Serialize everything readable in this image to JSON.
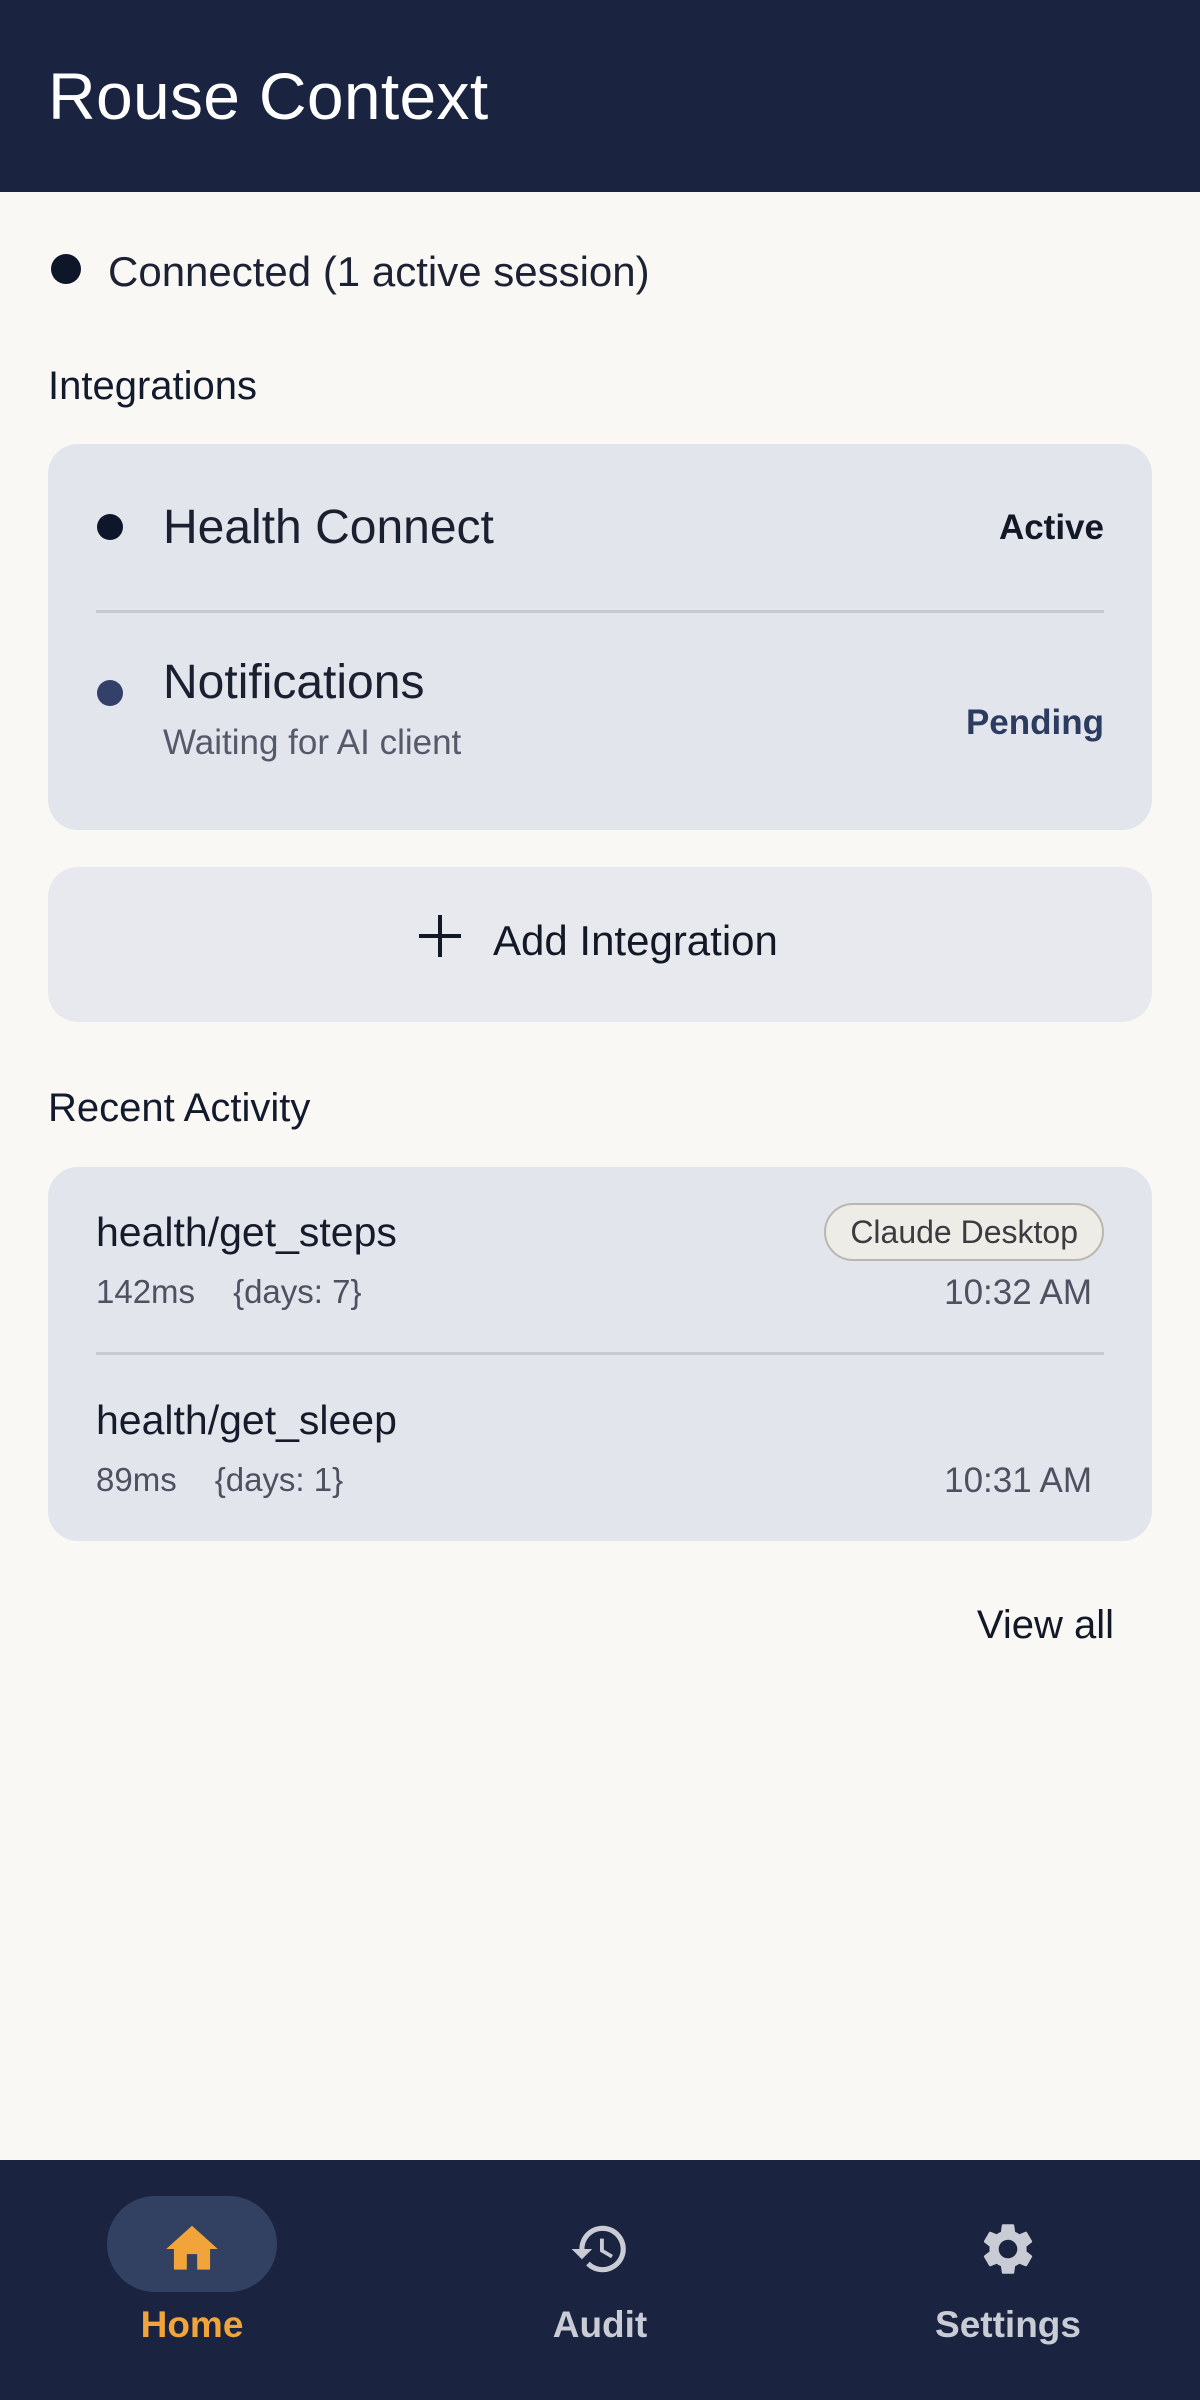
{
  "app": {
    "title": "Rouse Context"
  },
  "connection": {
    "status_text": "Connected (1 active session)"
  },
  "integrations": {
    "title": "Integrations",
    "items": [
      {
        "name": "Health Connect",
        "subtitle": "",
        "status": "Active",
        "status_color": "#121826",
        "dot_color": "#0e1729"
      },
      {
        "name": "Notifications",
        "subtitle": "Waiting for AI client",
        "status": "Pending",
        "status_color": "#2c3c60",
        "dot_color": "#32406a"
      }
    ],
    "add_label": "Add Integration"
  },
  "activity": {
    "title": "Recent Activity",
    "items": [
      {
        "tool": "health/get_steps",
        "duration": "142ms",
        "args": "{days: 7}",
        "time": "10:32 AM",
        "client": "Claude Desktop"
      },
      {
        "tool": "health/get_sleep",
        "duration": "89ms",
        "args": "{days: 1}",
        "time": "10:31 AM",
        "client": ""
      }
    ],
    "view_all_label": "View all"
  },
  "nav": {
    "items": [
      {
        "label": "Home",
        "icon": "home-icon",
        "active": true
      },
      {
        "label": "Audit",
        "icon": "history-icon",
        "active": false
      },
      {
        "label": "Settings",
        "icon": "gear-icon",
        "active": false
      }
    ]
  },
  "colors": {
    "bar_bg": "#1a2440",
    "page_bg": "#f9f8f5",
    "card_bg": "#e2e5ec",
    "nav_active": "#f0a43a",
    "nav_inactive": "#c9ccd5",
    "pending": "#2c3c60"
  }
}
